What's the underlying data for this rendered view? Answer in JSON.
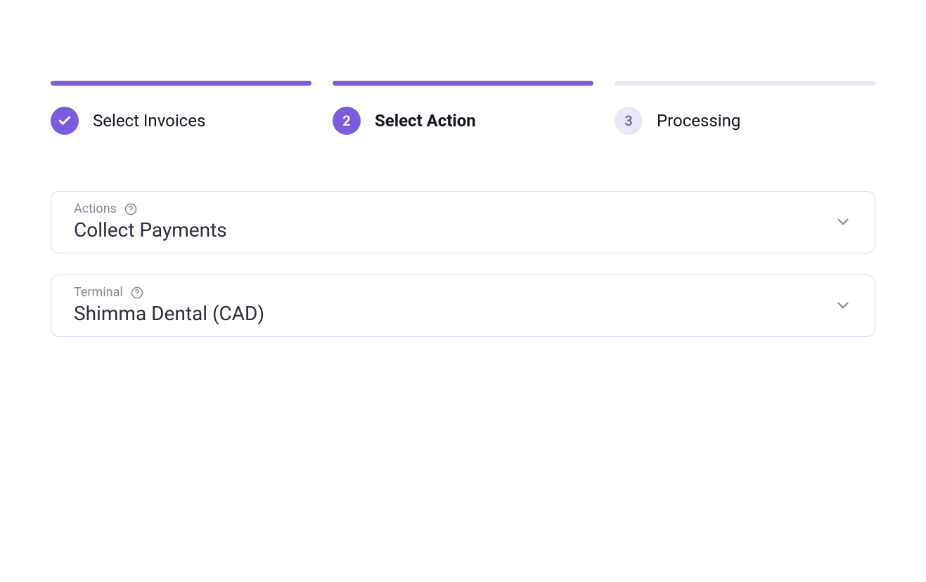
{
  "stepper": {
    "steps": [
      {
        "label": "Select Invoices",
        "state": "completed"
      },
      {
        "label": "Select Action",
        "number": "2",
        "state": "active"
      },
      {
        "label": "Processing",
        "number": "3",
        "state": "inactive"
      }
    ]
  },
  "form": {
    "actions": {
      "label": "Actions",
      "value": "Collect Payments"
    },
    "terminal": {
      "label": "Terminal",
      "value": "Shimma Dental (CAD)"
    }
  },
  "colors": {
    "primary": "#7c5cde",
    "inactiveBar": "#ebe6fa",
    "border": "#dcd6f3",
    "textDark": "#15131f",
    "textValue": "#2d2a3f",
    "textMuted": "#8b8799"
  }
}
